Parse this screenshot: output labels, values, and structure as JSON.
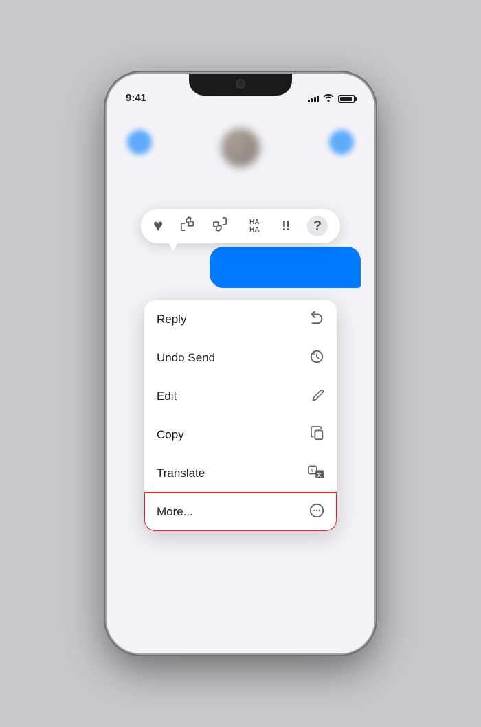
{
  "phone": {
    "time": "9:41",
    "status": {
      "signal_bars": [
        4,
        6,
        8,
        10,
        12
      ],
      "wifi": "wifi",
      "battery": "battery"
    }
  },
  "reaction_bar": {
    "emojis": [
      {
        "name": "heart",
        "symbol": "♥",
        "label": "Love"
      },
      {
        "name": "thumbs-up",
        "symbol": "👍",
        "label": "Like"
      },
      {
        "name": "thumbs-down",
        "symbol": "👎",
        "label": "Dislike"
      },
      {
        "name": "haha",
        "symbol": "HA\nHA",
        "label": "Haha"
      },
      {
        "name": "exclamation",
        "symbol": "‼",
        "label": "Emphasize"
      },
      {
        "name": "question",
        "symbol": "?",
        "label": "Question"
      }
    ]
  },
  "context_menu": {
    "items": [
      {
        "id": "reply",
        "label": "Reply",
        "icon": "↩"
      },
      {
        "id": "undo-send",
        "label": "Undo Send",
        "icon": "↺"
      },
      {
        "id": "edit",
        "label": "Edit",
        "icon": "✏"
      },
      {
        "id": "copy",
        "label": "Copy",
        "icon": "⧉"
      },
      {
        "id": "translate",
        "label": "Translate",
        "icon": "🗨"
      },
      {
        "id": "more",
        "label": "More...",
        "icon": "⊙",
        "highlighted": true
      }
    ]
  }
}
